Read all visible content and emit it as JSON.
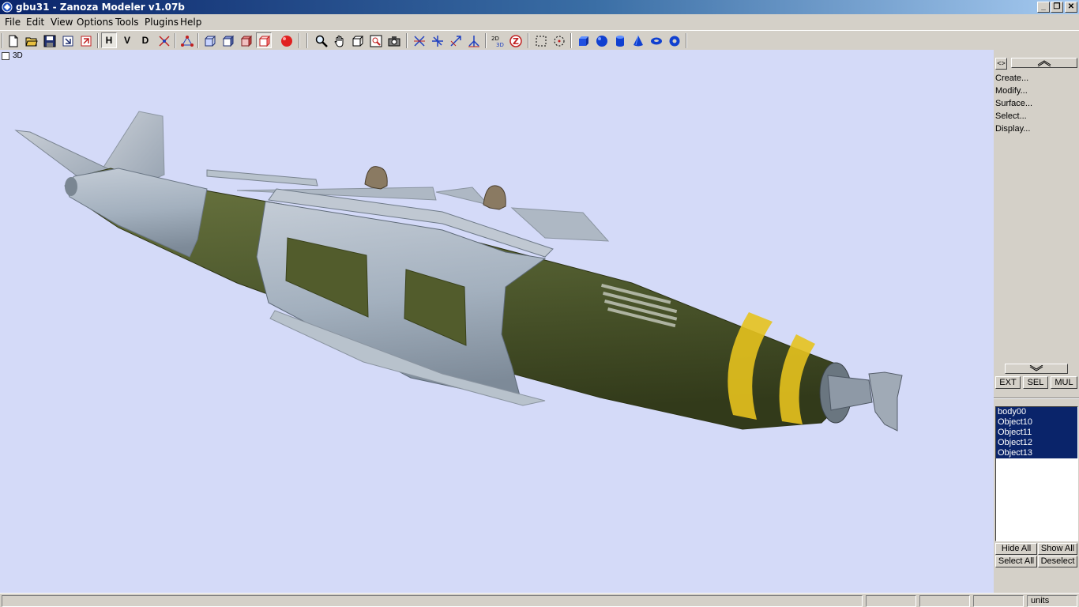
{
  "window": {
    "title": "gbu31 - Zanoza Modeler v1.07b"
  },
  "menu": [
    "File",
    "Edit",
    "View",
    "Options",
    "Tools",
    "Plugins",
    "Help"
  ],
  "toolbar": {
    "h_label": "H",
    "v_label": "V",
    "d_label": "D"
  },
  "viewport": {
    "label": "3D",
    "background": "#d4daf8"
  },
  "panel": {
    "toggle_label": "<>",
    "commands": [
      "Create...",
      "Modify...",
      "Surface...",
      "Select...",
      "Display..."
    ],
    "mode_buttons": [
      "EXT",
      "SEL",
      "MUL"
    ],
    "objects": [
      "body00",
      "Object10",
      "Object11",
      "Object12",
      "Object13"
    ],
    "hide_all": "Hide All",
    "show_all": "Show All",
    "select_all": "Select All",
    "deselect": "Deselect"
  },
  "status": {
    "units": "units"
  },
  "colors": {
    "selection": "#0a246a",
    "stripe": "#e6c21e",
    "body": "#4f5a2e",
    "metal": "#a3b0be"
  }
}
